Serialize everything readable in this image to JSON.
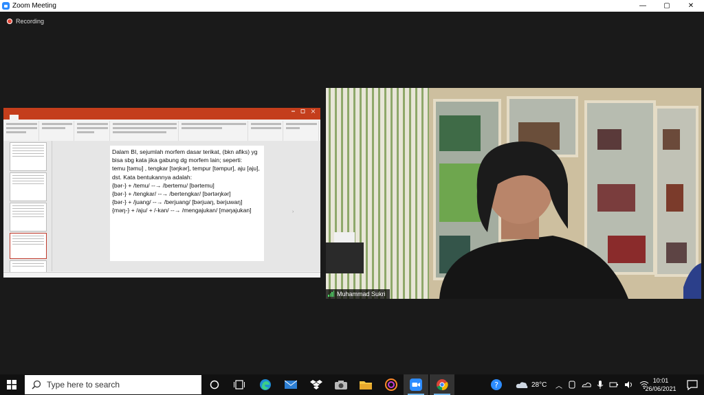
{
  "window": {
    "title": "Zoom Meeting"
  },
  "controls": {
    "minimize": "—",
    "maximize": "▢",
    "close": "✕"
  },
  "recording": {
    "label": "Recording"
  },
  "slide": {
    "lines": [
      "Dalam BI, sejumlah morfem dasar terikat, (bkn afiks) yg bisa sbg kata jika gabung dg morfem lain; seperti:",
      "temu [təmu] , tengkar [təŋkər], tempur [təmpur], aju [aju], dst. Kata bentukannya adalah:",
      "{bər-}  + /temu/ --→ /bertemu/ [bərtemu]",
      "{bər-}  + /tengkar/ --→ /bertengkar/ [bərtəŋkər]",
      "{bər-}  + /juang/ --→ /berjuang/ [bərjuaŋ, bərjuwaŋ]",
      "{məŋ-} + /aju/ + /-kan/  --→ /mengajukan/ [məŋajukan]"
    ]
  },
  "video": {
    "participant_name": "Muhammad Sukri"
  },
  "taskbar": {
    "search_placeholder": "Type here to search",
    "weather": "28°C",
    "time": "10:01",
    "date": "26/06/2021"
  },
  "colors": {
    "zoom_blue": "#2d8cff",
    "ppt_red": "#c43e1c",
    "taskbar": "#111111",
    "canvas": "#1a1a1a"
  }
}
